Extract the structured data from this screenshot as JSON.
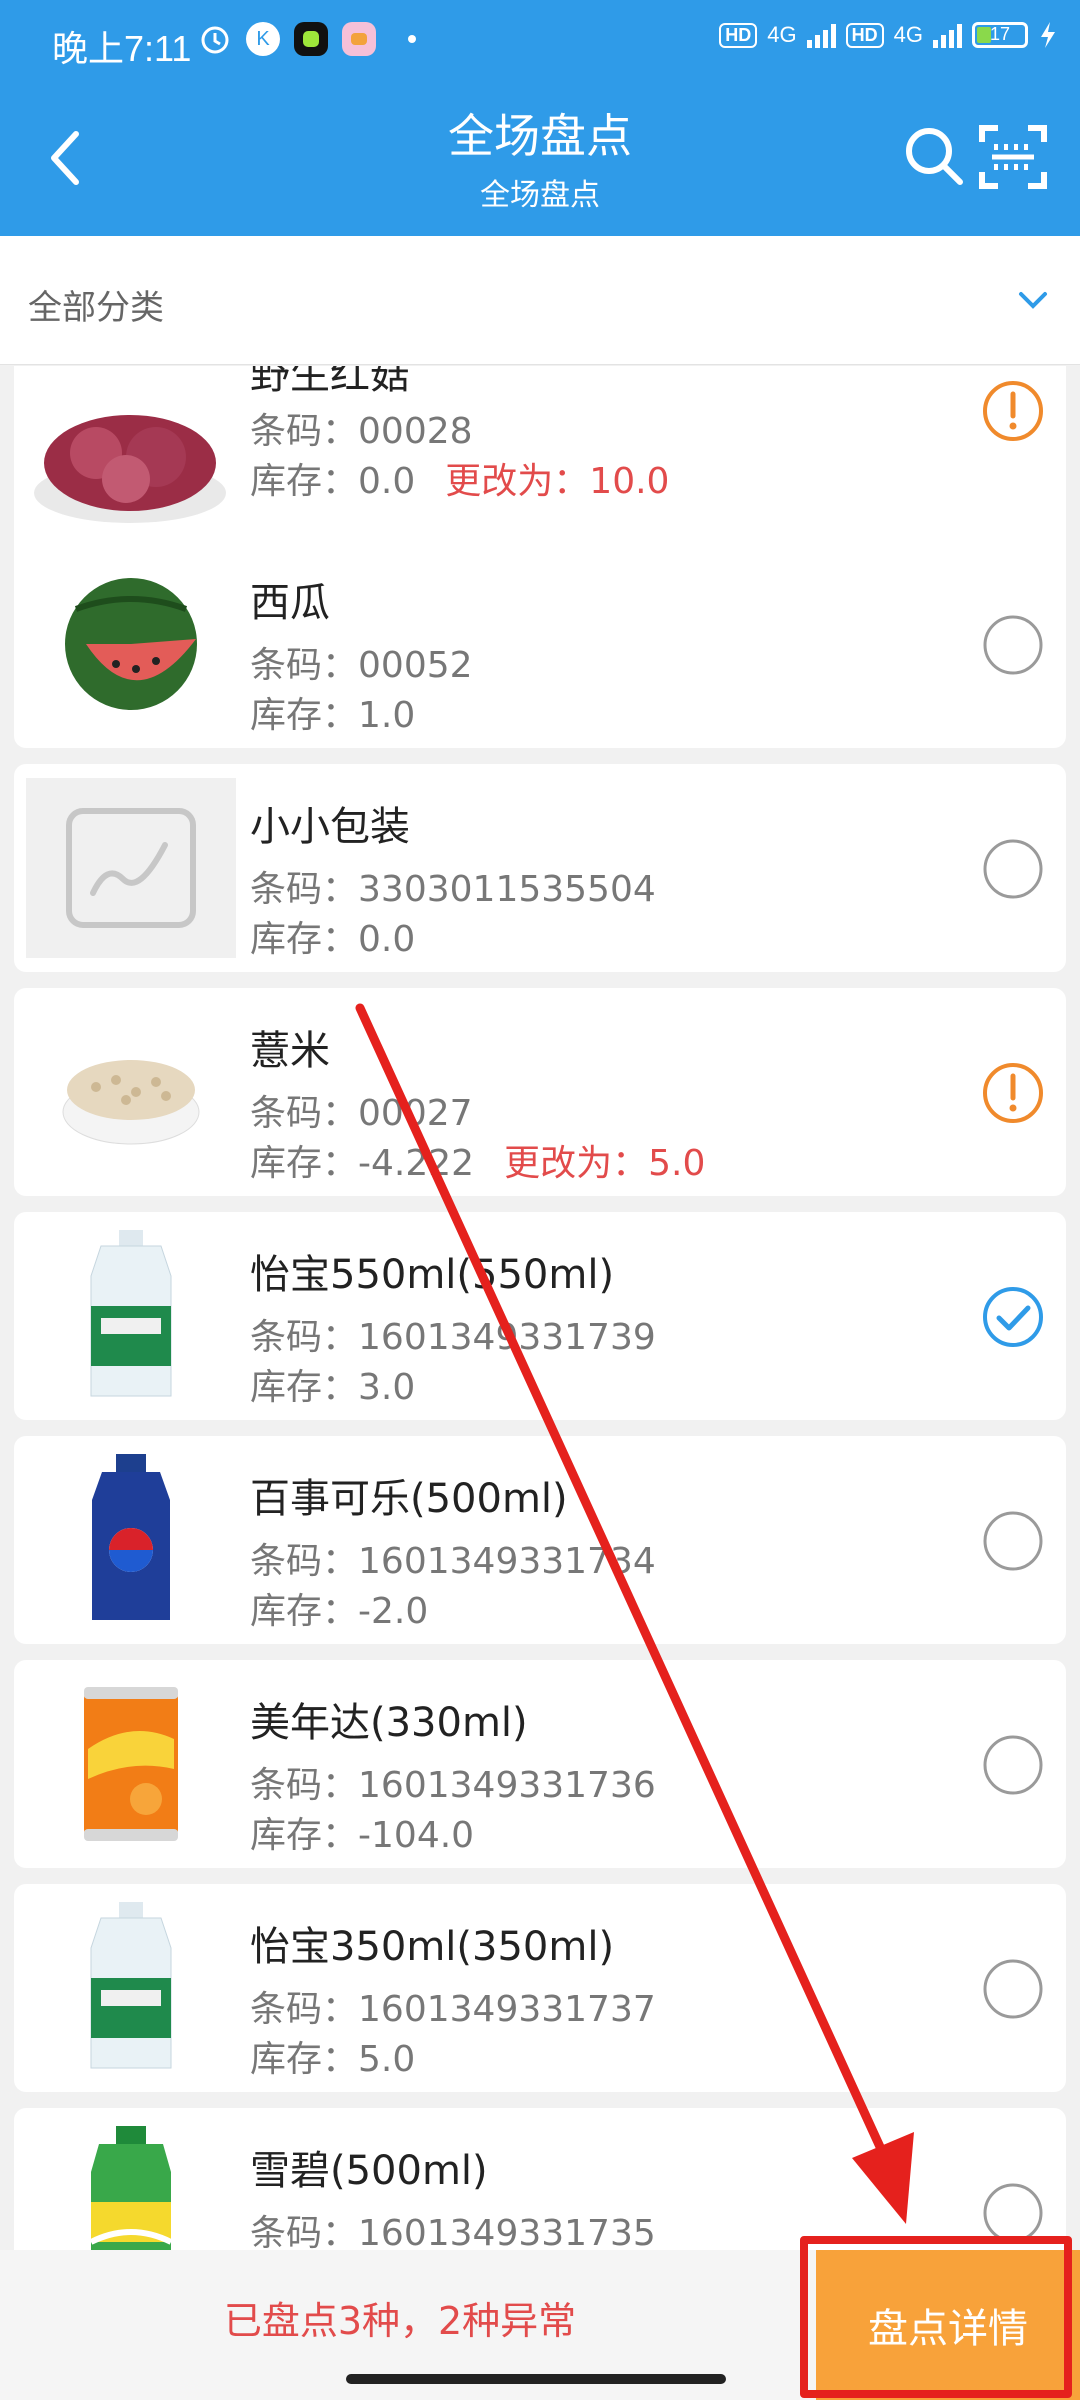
{
  "status_bar": {
    "time": "晚上7:11",
    "hd1": "HD",
    "net1": "4G",
    "hd2": "HD",
    "net2": "4G",
    "battery": "17"
  },
  "header": {
    "title": "全场盘点",
    "subtitle": "全场盘点"
  },
  "category": {
    "label": "全部分类"
  },
  "labels": {
    "barcode": "条码：",
    "stock": "库存：",
    "changed": "更改为："
  },
  "items": [
    {
      "name": "野生红菇",
      "barcode": "00028",
      "stock": "0.0",
      "changed_to": "10.0",
      "status": "warning"
    },
    {
      "name": "西瓜",
      "barcode": "00052",
      "stock": "1.0",
      "status": "unchecked"
    },
    {
      "name": "小小包装",
      "barcode": "3303011535504",
      "stock": "0.0",
      "status": "unchecked"
    },
    {
      "name": "薏米",
      "barcode": "00027",
      "stock": "-4.222",
      "changed_to": "5.0",
      "status": "warning"
    },
    {
      "name": "怡宝550ml(550ml)",
      "barcode": "1601349331739",
      "stock": "3.0",
      "status": "checked"
    },
    {
      "name": "百事可乐(500ml)",
      "barcode": "1601349331734",
      "stock": "-2.0",
      "status": "unchecked"
    },
    {
      "name": "美年达(330ml)",
      "barcode": "1601349331736",
      "stock": "-104.0",
      "status": "unchecked"
    },
    {
      "name": "怡宝350ml(350ml)",
      "barcode": "1601349331737",
      "stock": "5.0",
      "status": "unchecked"
    },
    {
      "name": "雪碧(500ml)",
      "barcode": "1601349331735",
      "stock": "",
      "status": "unchecked"
    }
  ],
  "bottom": {
    "summary": "已盘点3种，2种异常",
    "detail_button": "盘点详情"
  },
  "colors": {
    "primary": "#2f9be8",
    "warning": "#f08a2c",
    "danger": "#e24b4b",
    "action": "#f8a23a"
  }
}
